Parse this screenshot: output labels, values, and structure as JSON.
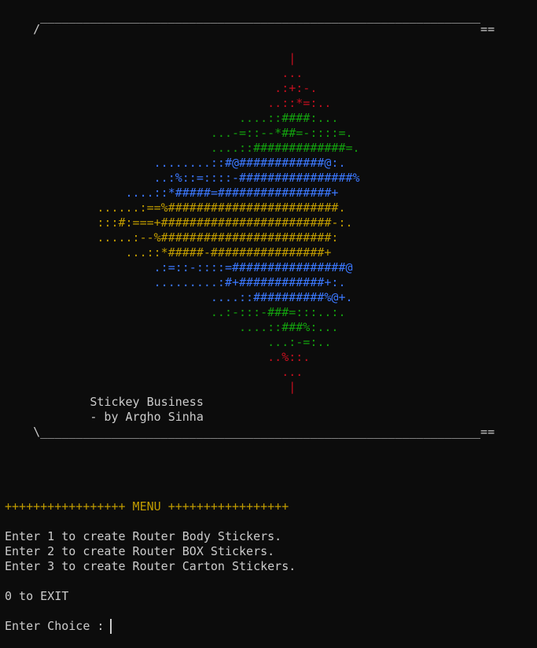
{
  "banner": {
    "top_border": "     ______________________________________________________________",
    "top_border_2": "    /                                                              ==",
    "bottom_border": "    \\______________________________________________________________==",
    "title": "            Stickey Business",
    "author": "            - by Argho Sinha"
  },
  "art": [
    {
      "text": "                                        |",
      "color": "red"
    },
    {
      "text": "                                       ...",
      "color": "red"
    },
    {
      "text": "                                      .:+:-.",
      "color": "red"
    },
    {
      "text": "                                     ..::*=:..",
      "color": "red"
    },
    {
      "text": "                                 ....::####:...",
      "color": "green"
    },
    {
      "text": "                             ...-=::--*##=-::::=.",
      "color": "green"
    },
    {
      "text": "                             ....::#############=.",
      "color": "green"
    },
    {
      "text": "                     ........::#@############@:.",
      "color": "blue"
    },
    {
      "text": "                     ..:%::=::::-################%",
      "color": "blue"
    },
    {
      "text": "                 ....::*#####=################+",
      "color": "blue"
    },
    {
      "text": "             ......:==%########################.",
      "color": "yellow"
    },
    {
      "text": "             :::#:===+########################-:.",
      "color": "yellow"
    },
    {
      "text": "             .....:--%########################:",
      "color": "yellow"
    },
    {
      "text": "                 ...::*#####-################+",
      "color": "yellow"
    },
    {
      "text": "                     .:=::-::::=################@",
      "color": "blue"
    },
    {
      "text": "                     .........:#+############+:.",
      "color": "blue"
    },
    {
      "text": "                             ....::##########%@+.",
      "color": "blue"
    },
    {
      "text": "                             ..:-:::-###=:::..:.",
      "color": "green"
    },
    {
      "text": "                                 ....::###%:...",
      "color": "green"
    },
    {
      "text": "                                     ...:-=:..",
      "color": "green"
    },
    {
      "text": "                                     ..%::.",
      "color": "red"
    },
    {
      "text": "                                       ...",
      "color": "red"
    },
    {
      "text": "                                        |",
      "color": "red"
    }
  ],
  "menu": {
    "header": "+++++++++++++++++ MENU +++++++++++++++++",
    "options": [
      "Enter 1 to create Router Body Stickers.",
      "Enter 2 to create Router BOX Stickers.",
      "Enter 3 to create Router Carton Stickers."
    ],
    "exit": "0 to EXIT",
    "prompt": "Enter Choice : "
  },
  "colors": {
    "background": "#0c0c0c",
    "text": "#cccccc",
    "red": "#c50f1f",
    "green": "#13a10e",
    "blue": "#3b78ff",
    "yellow": "#c19c00"
  }
}
